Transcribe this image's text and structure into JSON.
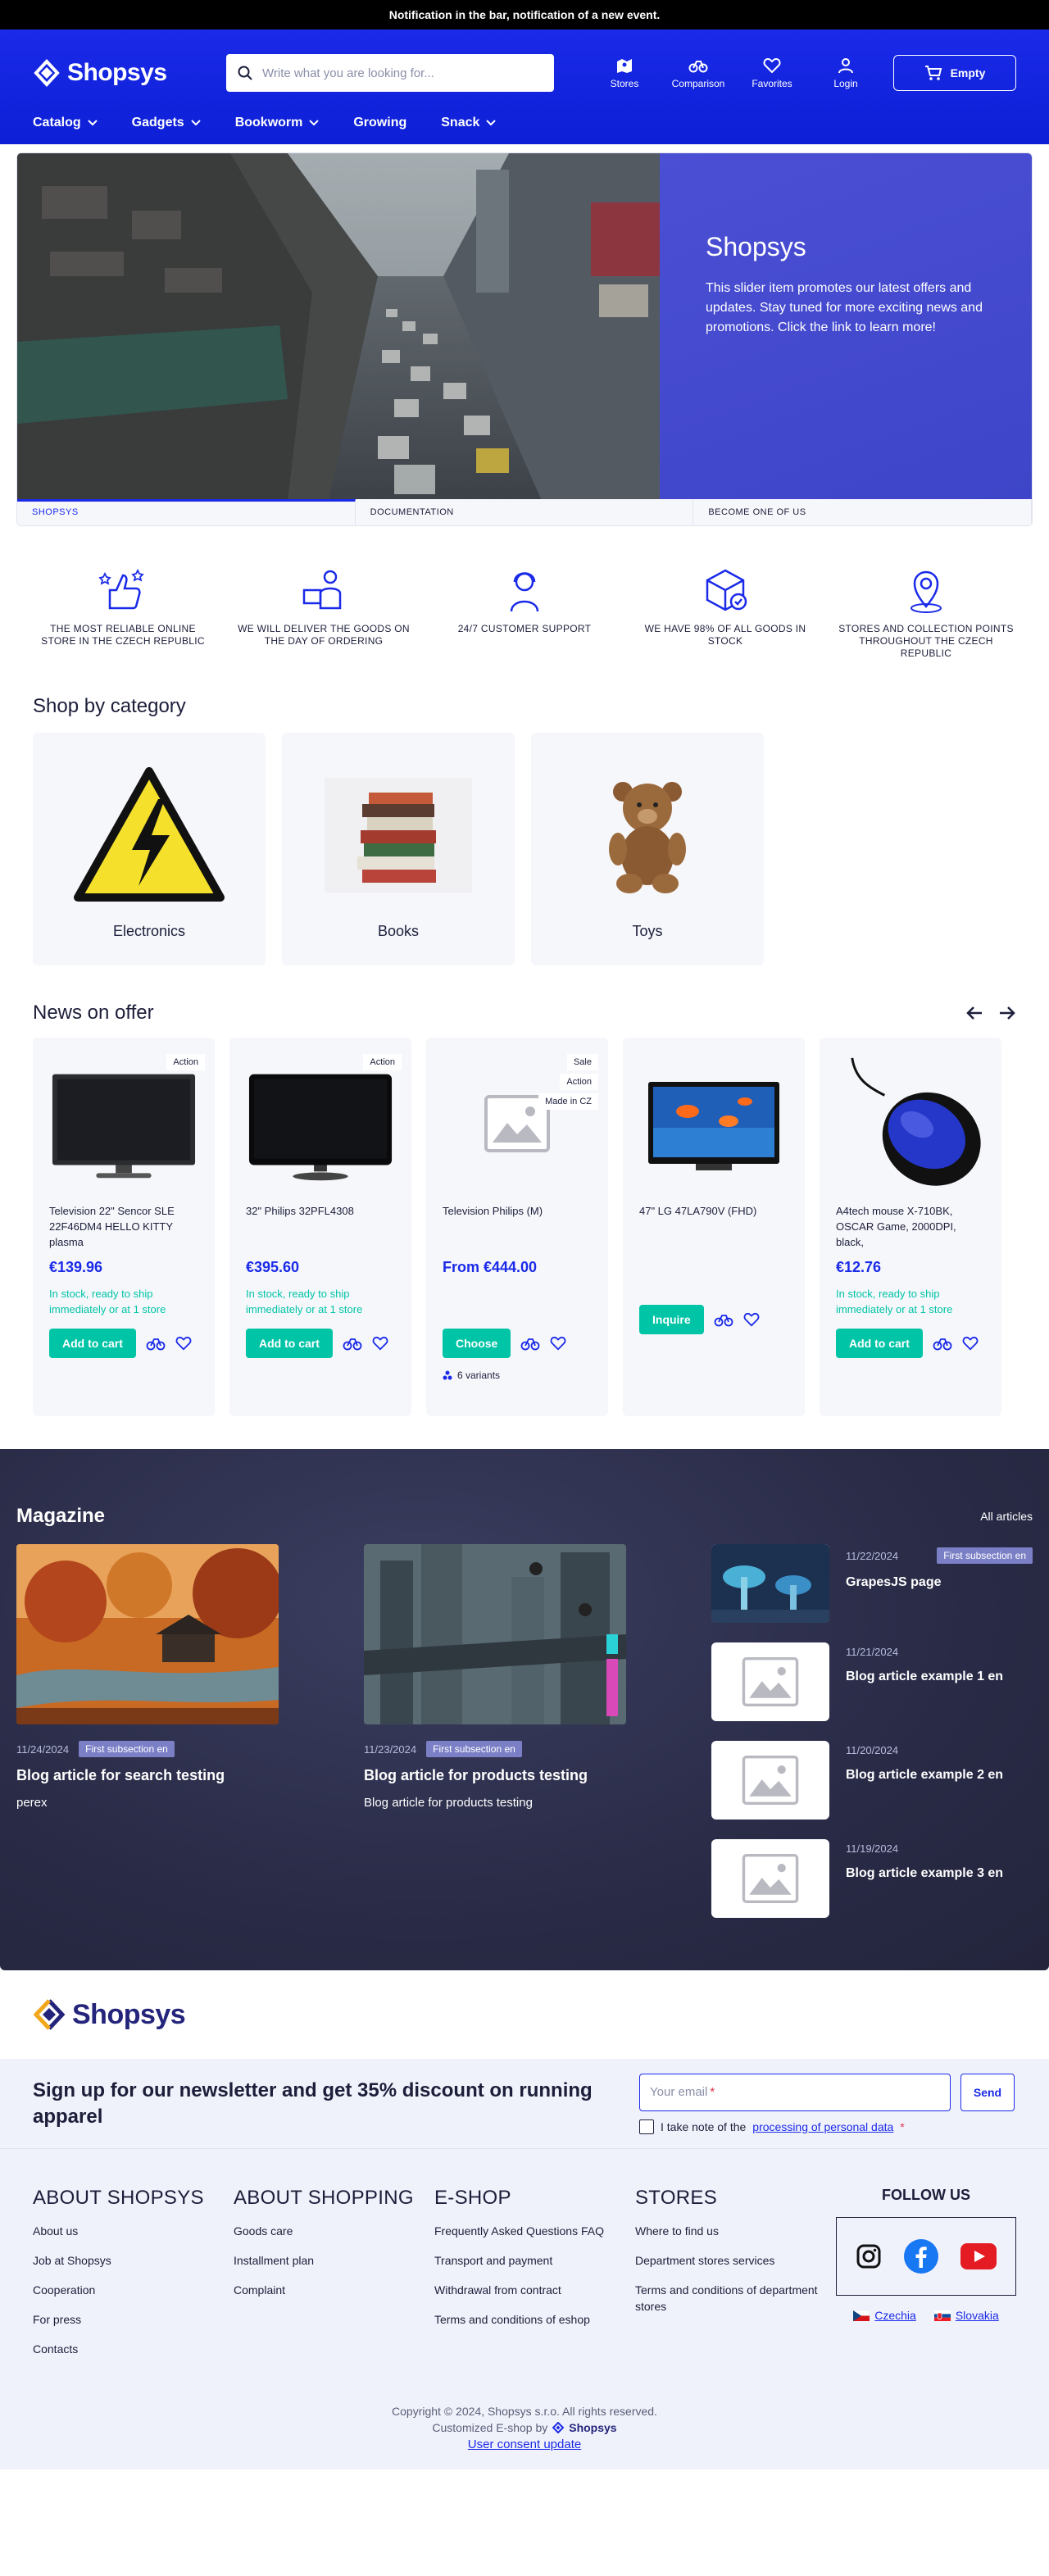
{
  "notification": "Notification in the bar, notification of a new event.",
  "header": {
    "logo": "Shopsys",
    "search_placeholder": "Write what you are looking for...",
    "icons": [
      {
        "label": "Stores",
        "icon": "stores-icon"
      },
      {
        "label": "Comparison",
        "icon": "comparison-icon"
      },
      {
        "label": "Favorites",
        "icon": "heart-icon"
      },
      {
        "label": "Login",
        "icon": "user-icon"
      }
    ],
    "cart_label": "Empty"
  },
  "nav": [
    {
      "label": "Catalog",
      "has_dropdown": true
    },
    {
      "label": "Gadgets",
      "has_dropdown": true
    },
    {
      "label": "Bookworm",
      "has_dropdown": true
    },
    {
      "label": "Growing",
      "has_dropdown": false
    },
    {
      "label": "Snack",
      "has_dropdown": true
    }
  ],
  "hero": {
    "title": "Shopsys",
    "text": "This slider item promotes our latest offers and updates. Stay tuned for more exciting news and promotions. Click the link to learn more!",
    "tabs": [
      "SHOPSYS",
      "DOCUMENTATION",
      "BECOME ONE OF US"
    ],
    "active_tab": 0
  },
  "benefits": [
    "THE MOST RELIABLE ONLINE STORE IN THE CZECH REPUBLIC",
    "WE WILL DELIVER THE GOODS ON THE DAY OF ORDERING",
    "24/7 CUSTOMER SUPPORT",
    "WE HAVE 98% OF ALL GOODS IN STOCK",
    "STORES AND COLLECTION POINTS THROUGHOUT THE CZECH REPUBLIC"
  ],
  "categories": {
    "title": "Shop by category",
    "items": [
      "Electronics",
      "Books",
      "Toys"
    ]
  },
  "news": {
    "title": "News on offer",
    "products": [
      {
        "name": "Television 22\" Sencor SLE 22F46DM4 HELLO KITTY plasma",
        "price": "€139.96",
        "stock": "In stock, ready to ship immediately or at 1 store",
        "button": "Add to cart",
        "flags": [
          "Action"
        ],
        "variants": ""
      },
      {
        "name": "32\" Philips 32PFL4308",
        "price": "€395.60",
        "stock": "In stock, ready to ship immediately or at 1 store",
        "button": "Add to cart",
        "flags": [
          "Action"
        ],
        "variants": ""
      },
      {
        "name": "Television Philips (M)",
        "price": "From €444.00",
        "stock": "",
        "button": "Choose",
        "flags": [
          "Sale",
          "Action",
          "Made in CZ"
        ],
        "variants": "6 variants"
      },
      {
        "name": "47\" LG 47LA790V (FHD)",
        "price": "",
        "stock": "",
        "button": "Inquire",
        "flags": [],
        "variants": ""
      },
      {
        "name": "A4tech mouse X-710BK, OSCAR Game, 2000DPI, black,",
        "price": "€12.76",
        "stock": "In stock, ready to ship immediately or at 1 store",
        "button": "Add to cart",
        "flags": [],
        "variants": ""
      }
    ]
  },
  "magazine": {
    "title": "Magazine",
    "all_link": "All articles",
    "featured": [
      {
        "date": "11/24/2024",
        "badge": "First subsection en",
        "title": "Blog article for search testing",
        "perex": "perex"
      },
      {
        "date": "11/23/2024",
        "badge": "First subsection en",
        "title": "Blog article for products testing",
        "perex": "Blog article for products testing"
      }
    ],
    "list": [
      {
        "date": "11/22/2024",
        "badge": "First subsection en",
        "title": "GrapesJS page"
      },
      {
        "date": "11/21/2024",
        "badge": "",
        "title": "Blog article example 1 en"
      },
      {
        "date": "11/20/2024",
        "badge": "",
        "title": "Blog article example 2 en"
      },
      {
        "date": "11/19/2024",
        "badge": "",
        "title": "Blog article example 3 en"
      }
    ]
  },
  "newsletter": {
    "text": "Sign up for our newsletter and get 35% discount on running apparel",
    "placeholder": "Your email",
    "required_mark": "*",
    "button": "Send",
    "consent_prefix": "I take note of the",
    "consent_link": "processing of personal data",
    "consent_mark": "*"
  },
  "footer": {
    "columns": [
      {
        "title": "ABOUT SHOPSYS",
        "links": [
          "About us",
          "Job at Shopsys",
          "Cooperation",
          "For press",
          "Contacts"
        ]
      },
      {
        "title": "ABOUT SHOPPING",
        "links": [
          "Goods care",
          "Installment plan",
          "Complaint"
        ]
      },
      {
        "title": "E-SHOP",
        "links": [
          "Frequently Asked Questions FAQ",
          "Transport and payment",
          "Withdrawal from contract",
          "Terms and conditions of eshop"
        ]
      },
      {
        "title": "STORES",
        "links": [
          "Where to find us",
          "Department stores services",
          "Terms and conditions of department stores"
        ]
      }
    ],
    "follow_title": "FOLLOW US",
    "social": [
      "instagram-icon",
      "facebook-icon",
      "youtube-icon"
    ],
    "languages": [
      "Czechia",
      "Slovakia"
    ],
    "copyright": "Copyright © 2024, Shopsys s.r.o. All rights reserved.",
    "customized": "Customized E-shop by",
    "brand": "Shopsys",
    "consent_update": "User consent update"
  },
  "colors": {
    "primary": "#1a2ae8",
    "accent_green": "#00c4a6",
    "hero_panel": "#4247cc",
    "magazine_bg": "#2a2c48",
    "footer_bg": "#f0f2fb"
  }
}
